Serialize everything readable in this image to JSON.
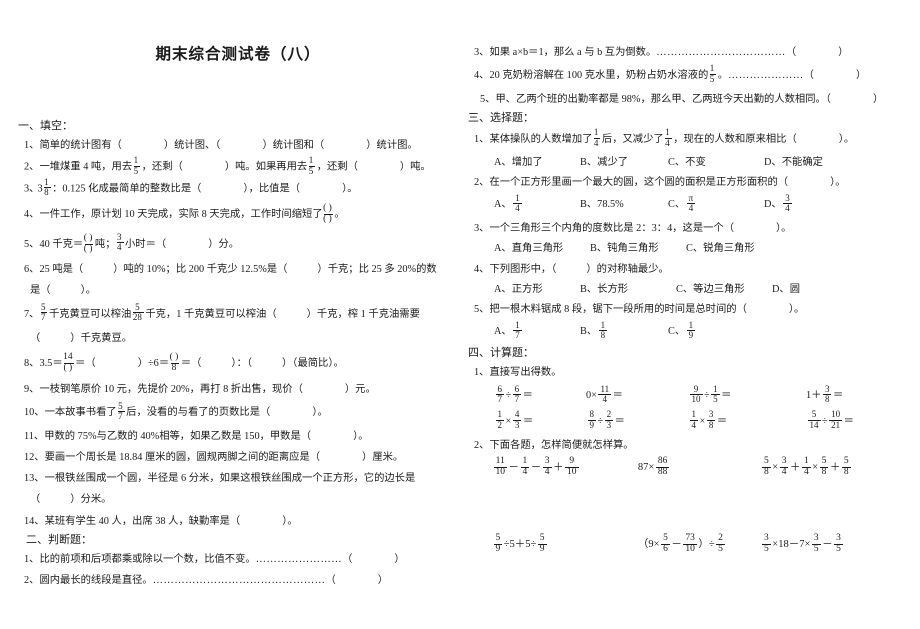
{
  "title": "期末综合测试卷（八）",
  "left_column": {
    "section1_head": "一、填空：",
    "fill_in": {
      "q1": {
        "no": "1、",
        "t1": "简单的统计图有（",
        "t2": "）统计图、（",
        "t3": "）统计图和（",
        "t4": "）统计图。"
      },
      "q2": {
        "no": "2、",
        "t1": "一堆煤重 4 吨，用去",
        "f1n": "1",
        "f1d": "5",
        "t2": "，还剩（",
        "t3": "）吨。如果再用去",
        "f2n": "1",
        "f2d": "5",
        "t4": "，还剩（",
        "t5": "）吨。"
      },
      "q3": {
        "no": "3、",
        "whole": "3",
        "fn": "1",
        "fd": "8",
        "t1": "：0.125 化成最简单的整数比是（",
        "t2": "），比值是（",
        "t3": "）。"
      },
      "q4": {
        "no": "4、",
        "t1": "一件工作，原计划 10 天完成，实际 8 天完成，工作时间缩短了",
        "fn": "(        )",
        "fd": "(       )",
        "t2": "。"
      },
      "q5": {
        "no": "5、",
        "t1": "40 千克＝",
        "fn": "(       )",
        "fd": "(      )",
        "t2": "吨；",
        "f2n": "3",
        "f2d": "4",
        "t3": "小时＝（",
        "t4": "）分。"
      },
      "q6": {
        "no": "6、",
        "t1": "25 吨是（",
        "t2": "）吨的 10%；比 200 千克少 12.5%是（",
        "t3": "）千克；比 25 多 20%的数",
        "t4": "是（",
        "t5": "）。"
      },
      "q7": {
        "no": "7、",
        "f1n": "5",
        "f1d": "7",
        "t1": "千克黄豆可以榨油",
        "f2n": "5",
        "f2d": "28",
        "t2": "千克，1 千克黄豆可以榨油（",
        "t3": "）千克，榨 1 千克油需要",
        "t4": "（",
        "t5": "）千克黄豆。"
      },
      "q8": {
        "no": "8、",
        "t1": "3.5＝",
        "f1n": "14",
        "f1d": "(      )",
        "t2": "＝（",
        "t3": "）÷6＝",
        "f2n": "(        )",
        "f2d": "8",
        "t4": "＝（",
        "t5": "）：（",
        "t6": "）（最简比）。"
      },
      "q9": {
        "no": "9、",
        "t1": "一枝钢笔原价 10 元，先提价 20%，再打 8 折出售，现价（",
        "t2": "）元。"
      },
      "q10": {
        "no": "10、",
        "t1": "一本故事书看了",
        "fn": "5",
        "fd": "7",
        "t2": "后，没看的与看了的页数比是（",
        "t3": "）。"
      },
      "q11": {
        "no": "11、",
        "t1": "甲数的 75%与乙数的 40%相等，如果乙数是 150，甲数是（",
        "t2": "）。"
      },
      "q12": {
        "no": "12、",
        "t1": "要画一个周长是 18.84 厘米的圆，圆规两脚之间的距离应是（",
        "t2": "）厘米。"
      },
      "q13": {
        "no": "13、",
        "t1": "一根铁丝围成一个圆，半径是 6 分米，如果这根铁丝围成一个正方形，它的边长是",
        "t2": "（",
        "t3": "）分米。"
      },
      "q14": {
        "no": "14、",
        "t1": "某班有学生 40 人，出席 38 人，缺勤率是（",
        "t2": "）。"
      }
    },
    "section2_head": "二、判断题：",
    "judge": {
      "q1": {
        "no": "1、",
        "t1": "比的前项和后项都乘或除以一个数，比值不变。",
        "dots": "……………………",
        "t2": "（",
        "t3": "）"
      },
      "q2": {
        "no": "2、",
        "t1": "圆内最长的线段是直径。",
        "dots": "…………………………………………",
        "t2": "（",
        "t3": "）"
      }
    }
  },
  "right_column": {
    "judge_cont": {
      "q3": {
        "no": "3、",
        "t1": "如果 a×b＝1，那么 a 与 b 互为倒数。",
        "dots": "………………………………",
        "t2": "（",
        "t3": "）"
      },
      "q4": {
        "no": "4、",
        "t1": "20 克奶粉溶解在 100 克水里，奶粉占奶水溶液的",
        "fn": "1",
        "fd": "5",
        "t2": "。",
        "dots": "…………………",
        "t3": "（",
        "t4": "）"
      },
      "q5": {
        "no": "5、",
        "t1": "甲、乙两个班的出勤率都是 98%，那么甲、乙两班今天出勤的人数相同。（",
        "t2": "）"
      }
    },
    "section3_head": "三、选择题：",
    "choice": {
      "q1": {
        "no": "1、",
        "t1": "某体操队的人数增加了",
        "f1n": "1",
        "f1d": "4",
        "t2": "后，又减少了",
        "f2n": "1",
        "f2d": "4",
        "t3": "，现在的人数和原来相比（",
        "t4": "）。",
        "options": [
          "A、增加了",
          "B、减少了",
          "C、不变",
          "D、不能确定"
        ]
      },
      "q2": {
        "no": "2、",
        "t1": "在一个正方形里画一个最大的圆，这个圆的面积是正方形面积的（",
        "t2": "）。",
        "options": [
          {
            "label": "A、",
            "num": "1",
            "den": "4"
          },
          {
            "label": "B、78.5%",
            "num": "",
            "den": ""
          },
          {
            "label": "C、",
            "num": "π",
            "den": "4"
          },
          {
            "label": "D、",
            "num": "3",
            "den": "4"
          }
        ]
      },
      "q3": {
        "no": "3、",
        "t1": "一个三角形三个内角的度数比是 2：3：4，这是一个（",
        "t2": "）。",
        "options": [
          "A、直角三角形",
          "B、钝角三角形",
          "C、锐角三角形"
        ]
      },
      "q4": {
        "no": "4、",
        "t1": "下列图形中，（",
        "t2": "）的对称轴最少。",
        "options": [
          "A、正方形",
          "B、长方形",
          "C、等边三角形",
          "D、圆"
        ]
      },
      "q5": {
        "no": "5、",
        "t1": "把一根木料锯成 8 段，锯下一段所用的时间是总时间的（",
        "t2": "）。",
        "options": [
          {
            "label": "A、",
            "num": "1",
            "den": "7"
          },
          {
            "label": "B、",
            "num": "1",
            "den": "8"
          },
          {
            "label": "C、",
            "num": "1",
            "den": "9"
          }
        ]
      }
    },
    "section4_head": "四、计算题：",
    "calc": {
      "sub1_head": "1、直接写出得数。",
      "oral_row1": [
        {
          "a_n": "6",
          "a_d": "7",
          "op": "÷",
          "b_n": "6",
          "b_d": "7",
          "eq": "＝"
        },
        {
          "pre": "0×",
          "b_n": "11",
          "b_d": "4",
          "eq": "＝"
        },
        {
          "a_n": "9",
          "a_d": "10",
          "op": "÷",
          "b_n": "1",
          "b_d": "5",
          "eq": "＝"
        },
        {
          "pre": "1＋",
          "b_n": "3",
          "b_d": "8",
          "eq": "＝"
        }
      ],
      "oral_row2": [
        {
          "a_n": "1",
          "a_d": "2",
          "op": "×",
          "b_n": "4",
          "b_d": "3",
          "eq": "＝"
        },
        {
          "a_n": "8",
          "a_d": "9",
          "op": "÷",
          "b_n": "2",
          "b_d": "3",
          "eq": "＝"
        },
        {
          "a_n": "1",
          "a_d": "4",
          "op": "×",
          "b_n": "3",
          "b_d": "8",
          "eq": "＝"
        },
        {
          "a_n": "5",
          "a_d": "14",
          "op": "÷",
          "b_n": "10",
          "b_d": "21",
          "eq": "＝"
        }
      ],
      "sub2_head": "2、下面各题，怎样简便就怎样算。",
      "expr_row1": {
        "e1": [
          {
            "type": "frac",
            "n": "11",
            "d": "10"
          },
          {
            "type": "op",
            "v": "－"
          },
          {
            "type": "frac",
            "n": "1",
            "d": "4"
          },
          {
            "type": "op",
            "v": "－"
          },
          {
            "type": "frac",
            "n": "3",
            "d": "4"
          },
          {
            "type": "op",
            "v": "＋"
          },
          {
            "type": "frac",
            "n": "9",
            "d": "10"
          }
        ],
        "e2": [
          {
            "type": "op",
            "v": "87×"
          },
          {
            "type": "frac",
            "n": "86",
            "d": "88"
          }
        ],
        "e3": [
          {
            "type": "frac",
            "n": "5",
            "d": "8"
          },
          {
            "type": "op",
            "v": "×"
          },
          {
            "type": "frac",
            "n": "3",
            "d": "4"
          },
          {
            "type": "op",
            "v": "＋"
          },
          {
            "type": "frac",
            "n": "1",
            "d": "4"
          },
          {
            "type": "op",
            "v": "×"
          },
          {
            "type": "frac",
            "n": "5",
            "d": "8"
          },
          {
            "type": "op",
            "v": "＋"
          },
          {
            "type": "frac",
            "n": "5",
            "d": "8"
          }
        ]
      },
      "expr_row2": {
        "e1": [
          {
            "type": "frac",
            "n": "5",
            "d": "9"
          },
          {
            "type": "op",
            "v": "÷5＋5÷"
          },
          {
            "type": "frac",
            "n": "5",
            "d": "9"
          }
        ],
        "e2": [
          {
            "type": "op",
            "v": "（9×"
          },
          {
            "type": "frac",
            "n": "5",
            "d": "6"
          },
          {
            "type": "op",
            "v": "－"
          },
          {
            "type": "frac",
            "n": "73",
            "d": "10"
          },
          {
            "type": "op",
            "v": "）÷"
          },
          {
            "type": "frac",
            "n": "2",
            "d": "5"
          }
        ],
        "e3": [
          {
            "type": "frac",
            "n": "3",
            "d": "5"
          },
          {
            "type": "op",
            "v": "×18－7×"
          },
          {
            "type": "frac",
            "n": "3",
            "d": "5"
          },
          {
            "type": "op",
            "v": "－"
          },
          {
            "type": "frac",
            "n": "3",
            "d": "5"
          }
        ]
      }
    }
  }
}
